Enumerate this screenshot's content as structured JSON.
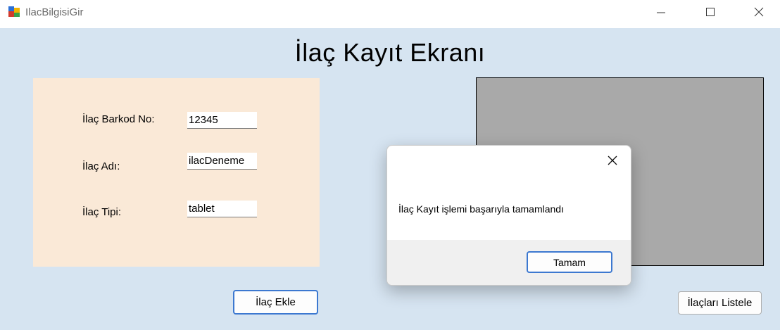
{
  "window": {
    "title": "IlacBilgisiGir"
  },
  "page": {
    "title": "İlaç Kayıt Ekranı"
  },
  "form": {
    "barcode_label": "İlaç Barkod No:",
    "barcode_value": "12345",
    "name_label": "İlaç Adı:",
    "name_value": "ilacDeneme",
    "type_label": "İlaç Tipi:",
    "type_value": "tablet"
  },
  "buttons": {
    "add_label": "İlaç Ekle",
    "list_label": "İlaçları Listele"
  },
  "dialog": {
    "message": "İlaç Kayıt işlemi başarıyla tamamlandı",
    "ok_label": "Tamam"
  },
  "colors": {
    "client_background": "#d6e4f1",
    "form_panel": "#fae9d7",
    "image_placeholder": "#a9a9a9",
    "accent_border": "#3c78d0"
  },
  "icons": {
    "app": "windows-form-app-icon",
    "minimize": "minimize-icon",
    "maximize": "maximize-icon",
    "close": "close-icon"
  }
}
